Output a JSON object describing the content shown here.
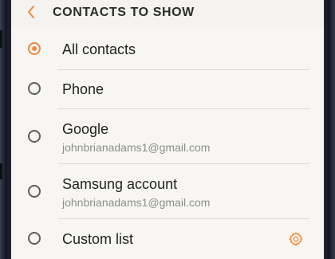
{
  "header": {
    "title": "CONTACTS TO SHOW"
  },
  "options": [
    {
      "label": "All contacts",
      "selected": true
    },
    {
      "label": "Phone",
      "selected": false
    },
    {
      "label": "Google",
      "account": "johnbrianadams1@gmail.com",
      "selected": false
    },
    {
      "label": "Samsung account",
      "account": "johnbrianadams1@gmail.com",
      "selected": false
    },
    {
      "label": "Custom list",
      "selected": false,
      "icon": "settings-gear-icon"
    }
  ],
  "colors": {
    "accent": "#f0883c",
    "background": "#f7f6f3",
    "text": "#222222",
    "secondary_text": "#8d8d8d"
  }
}
